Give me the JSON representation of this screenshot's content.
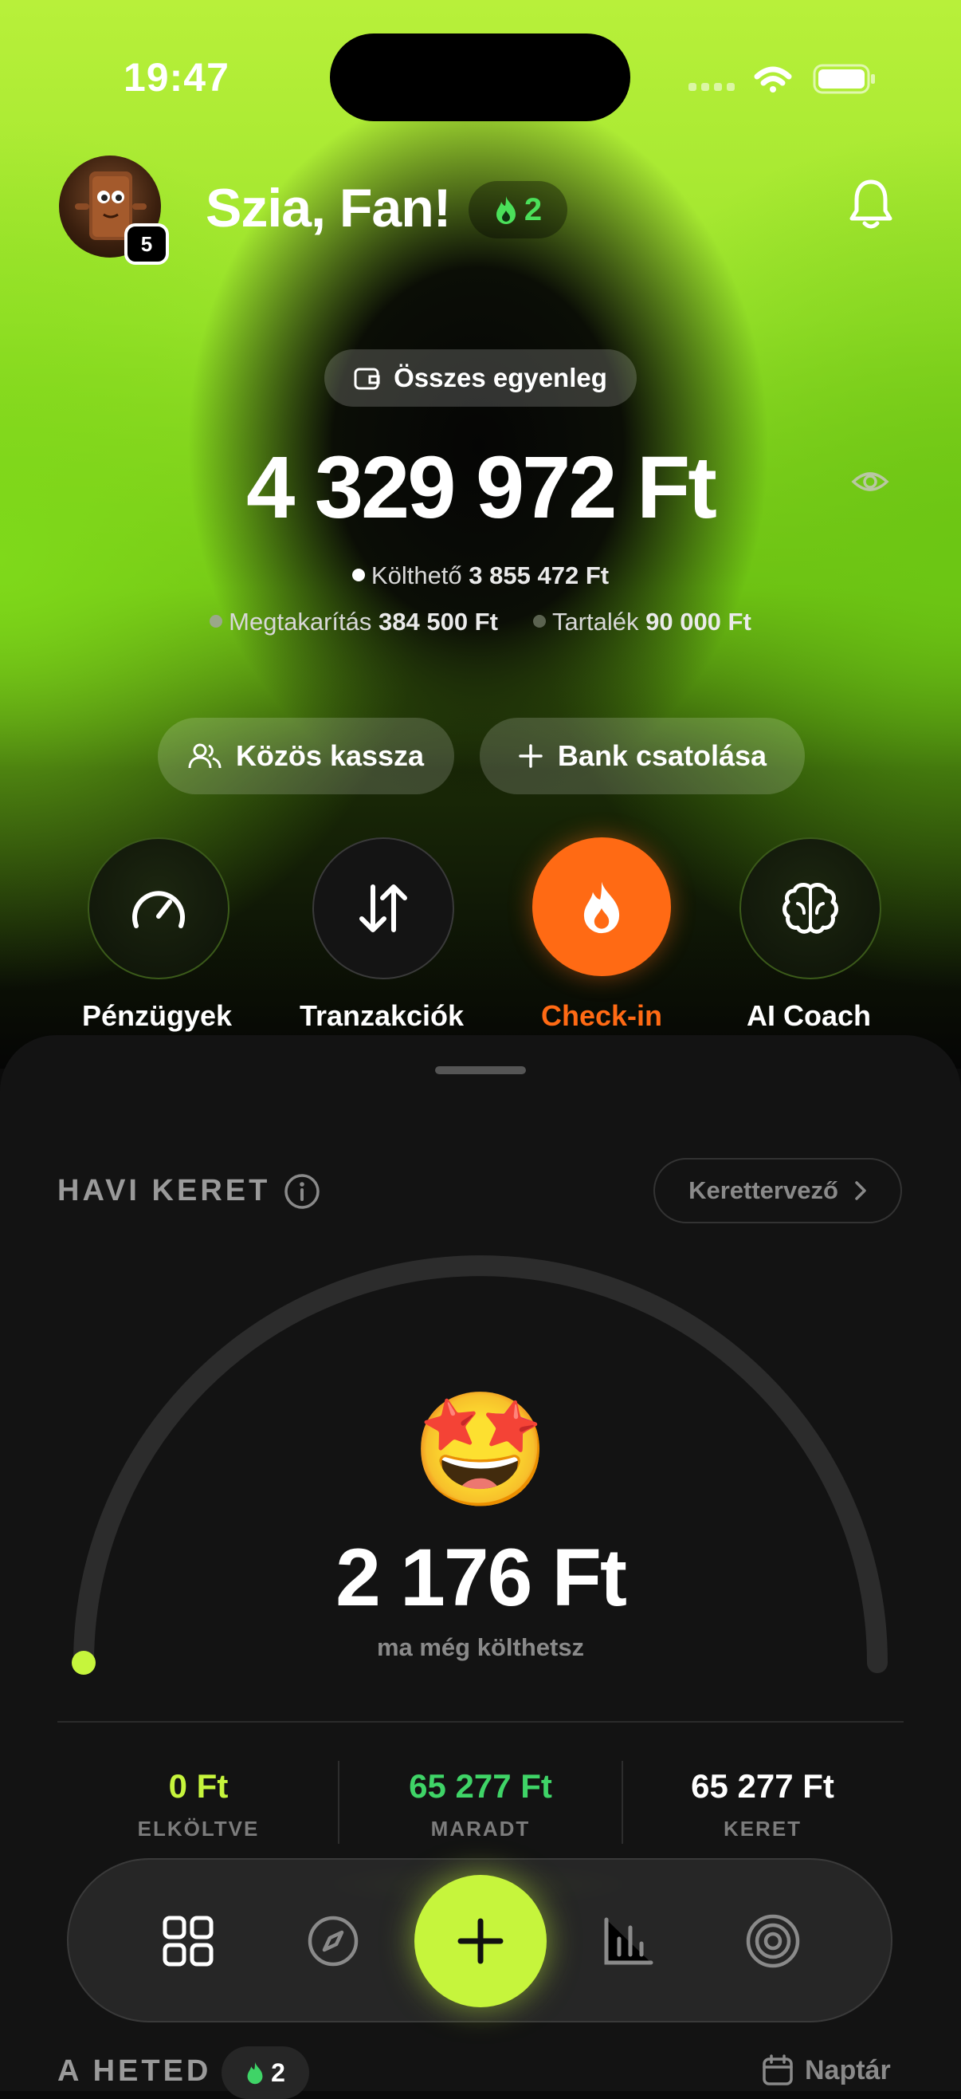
{
  "status_bar": {
    "time": "19:47"
  },
  "header": {
    "greeting": "Szia, Fan!",
    "avatar_level": "5",
    "streak": "2"
  },
  "balance": {
    "chip_label": "Összes egyenleg",
    "total": "4 329 972 Ft",
    "spendable_label": "Költhető",
    "spendable_value": "3 855 472 Ft",
    "savings_label": "Megtakarítás",
    "savings_value": "384 500 Ft",
    "reserve_label": "Tartalék",
    "reserve_value": "90 000 Ft"
  },
  "actions": {
    "shared_label": "Közös kassza",
    "bank_label": "Bank csatolása"
  },
  "quick_actions": [
    {
      "label": "Pénzügyek",
      "icon": "gauge-icon"
    },
    {
      "label": "Tranzakciók",
      "icon": "transfer-arrows-icon"
    },
    {
      "label": "Check-in",
      "icon": "flame-icon"
    },
    {
      "label": "AI Coach",
      "icon": "brain-icon"
    }
  ],
  "budget": {
    "title": "HAVI KERET",
    "planner_label": "Kerettervező",
    "emoji": "🤩",
    "remaining_today": "2 176 Ft",
    "remaining_sub": "ma még költhetsz",
    "progress_fraction": 0.0,
    "stats": [
      {
        "value": "0 Ft",
        "label": "ELKÖLTVE"
      },
      {
        "value": "65 277 Ft",
        "label": "MARADT"
      },
      {
        "value": "65 277 Ft",
        "label": "KERET"
      }
    ]
  },
  "week": {
    "title": "A HETED",
    "streak": "2",
    "calendar_label": "Naptár"
  },
  "colors": {
    "accent_lime": "#c6f53c",
    "streak_green": "#4be05a",
    "checkin_orange": "#ff6a14",
    "stat_green": "#3fd467"
  }
}
